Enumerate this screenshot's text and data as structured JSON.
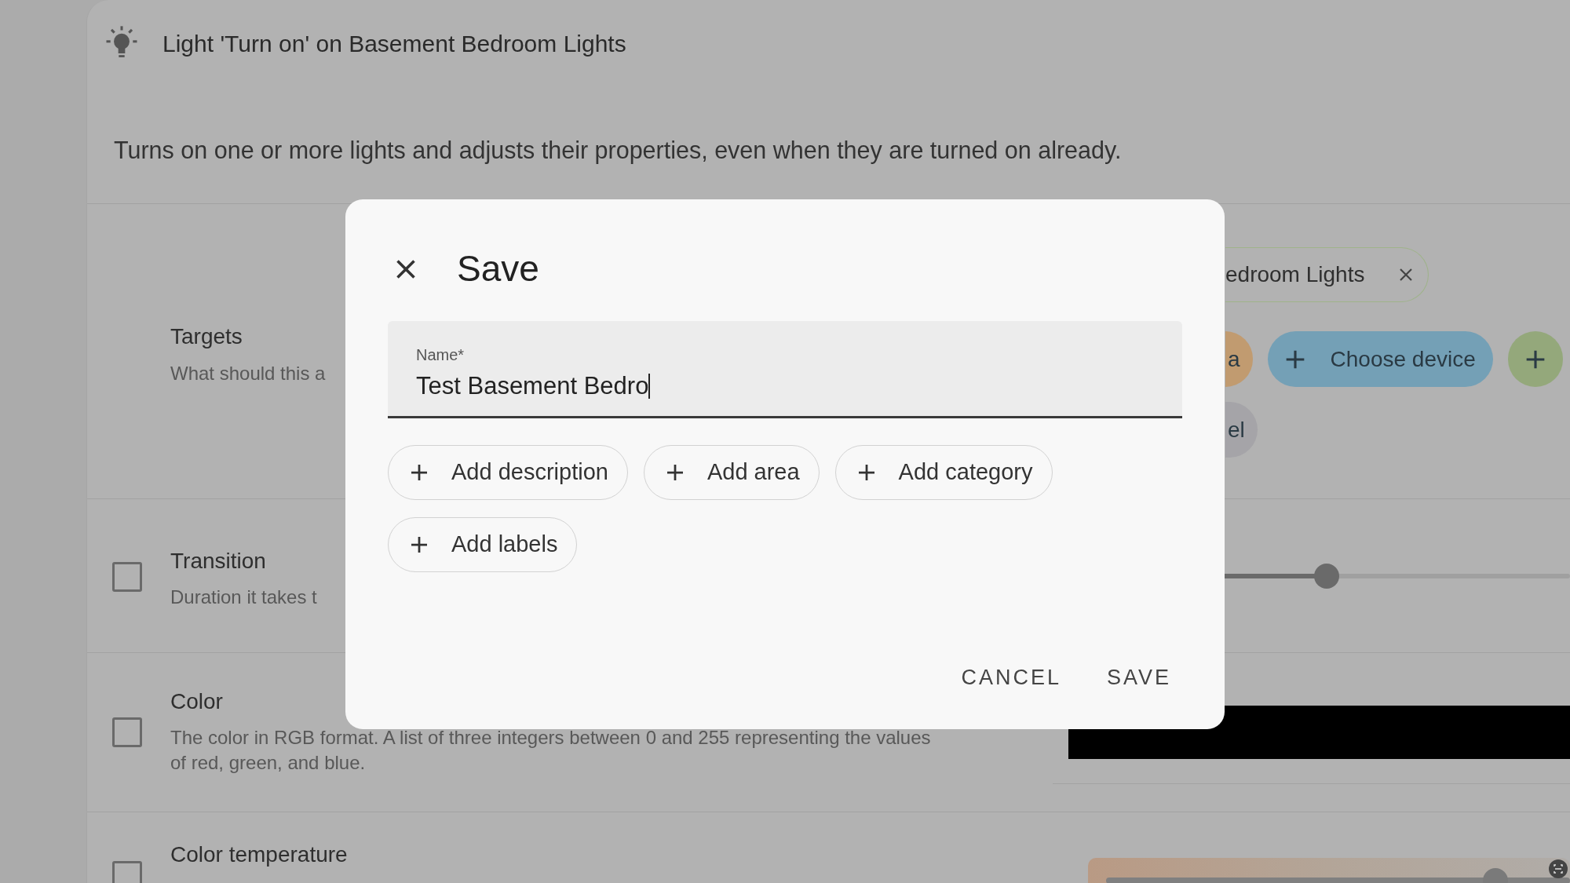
{
  "header": {
    "title": "Light 'Turn on' on Basement Bedroom Lights",
    "description": "Turns on one or more lights and adjusts their properties, even when they are turned on already."
  },
  "targets": {
    "label": "Targets",
    "description": "What should this a",
    "selected_chip": {
      "label": "edroom Lights"
    },
    "chip_rows": [
      [
        {
          "label": "a",
          "plus": false,
          "color": "#c19b70"
        },
        {
          "label": "Choose device",
          "plus": true,
          "color": "#74a0b6"
        },
        {
          "plus": true,
          "color": "#94a87b"
        }
      ],
      [
        {
          "label": "el",
          "plus": false,
          "color": "#a5a4a8"
        }
      ]
    ]
  },
  "fields": [
    {
      "kind": "slider",
      "title": "Transition",
      "description": "Duration it takes t",
      "checked": false,
      "level": 0.53
    },
    {
      "kind": "color",
      "title": "Color",
      "description": "The color in RGB format. A list of three integers between 0 and 255 representing the values of red, green, and blue.",
      "checked": false
    },
    {
      "kind": "color_temp",
      "title": "Color temperature",
      "checked": false,
      "level": 0.84
    }
  ],
  "dialog": {
    "title": "Save",
    "name_field": {
      "label": "Name*",
      "value": "Test Basement Bedro"
    },
    "chips": [
      "Add description",
      "Add area",
      "Add category",
      "Add labels"
    ],
    "actions": [
      "CANCEL",
      "SAVE"
    ]
  }
}
